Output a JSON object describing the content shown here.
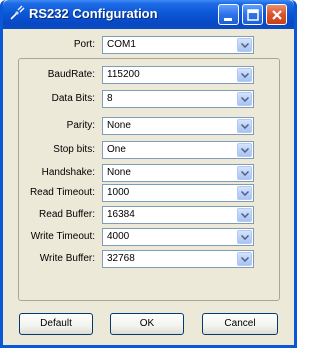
{
  "window": {
    "title": "RS232 Configuration"
  },
  "fields": {
    "port": {
      "label": "Port:",
      "value": "COM1"
    },
    "baud_rate": {
      "label": "BaudRate:",
      "value": "115200"
    },
    "data_bits": {
      "label": "Data Bits:",
      "value": "8"
    },
    "parity": {
      "label": "Parity:",
      "value": "None"
    },
    "stop_bits": {
      "label": "Stop bits:",
      "value": "One"
    },
    "handshake": {
      "label": "Handshake:",
      "value": "None"
    },
    "read_timeout": {
      "label": "Read Timeout:",
      "value": "1000"
    },
    "read_buffer": {
      "label": "Read Buffer:",
      "value": "16384"
    },
    "write_timeout": {
      "label": "Write Timeout:",
      "value": "4000"
    },
    "write_buffer": {
      "label": "Write Buffer:",
      "value": "32768"
    }
  },
  "buttons": {
    "default": "Default",
    "ok": "OK",
    "cancel": "Cancel"
  },
  "icons": {
    "title": "plug-icon",
    "minimize": "minimize-icon",
    "maximize": "maximize-icon",
    "close": "close-icon",
    "dropdown": "chevron-down-icon"
  },
  "colors": {
    "titlebar": "#0a58d6",
    "window_bg": "#ece9d8",
    "close_button": "#d9542c"
  }
}
